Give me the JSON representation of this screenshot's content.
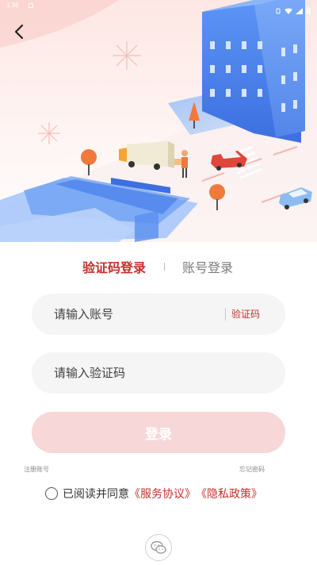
{
  "status_bar": {
    "time": "1:36"
  },
  "tabs": {
    "sms_login": "验证码登录",
    "account_login": "账号登录"
  },
  "account_field": {
    "placeholder": "请输入账号",
    "get_code": "验证码"
  },
  "code_field": {
    "placeholder": "请输入验证码"
  },
  "login_button": "登录",
  "links": {
    "register": "注册账号",
    "forgot_password": "忘记密码"
  },
  "agreement": {
    "prefix": "已阅读并同意",
    "service": "《服务协议》",
    "privacy": "《隐私政策》"
  },
  "colors": {
    "accent": "#c4302b",
    "login_button_disabled": "#f8d7d8",
    "field_bg": "#f5f5f5",
    "building": "#4f8ef0"
  },
  "icons": {
    "back": "chevron-left-icon",
    "wechat": "wechat-icon",
    "checkbox": "radio-unchecked-icon"
  }
}
